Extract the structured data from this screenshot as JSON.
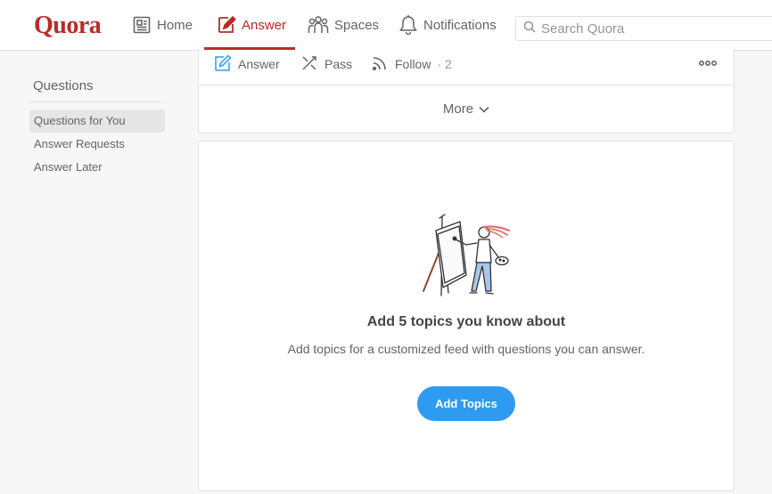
{
  "header": {
    "logo": "Quora",
    "nav": [
      {
        "label": "Home",
        "icon": "home-icon"
      },
      {
        "label": "Answer",
        "icon": "answer-pencil-icon",
        "active": true
      },
      {
        "label": "Spaces",
        "icon": "spaces-people-icon"
      },
      {
        "label": "Notifications",
        "icon": "bell-icon"
      }
    ],
    "search_placeholder": "Search Quora"
  },
  "sidebar": {
    "title": "Questions",
    "items": [
      {
        "label": "Questions for You",
        "active": true
      },
      {
        "label": "Answer Requests"
      },
      {
        "label": "Answer Later"
      }
    ]
  },
  "question_actions": {
    "answer": "Answer",
    "pass": "Pass",
    "follow": "Follow",
    "follow_count": "· 2",
    "more": "More"
  },
  "empty_state": {
    "title": "Add 5 topics you know about",
    "subtitle": "Add topics for a customized feed with questions you can answer.",
    "button": "Add Topics"
  },
  "colors": {
    "brand": "#b92b27",
    "button_blue": "#2e9bf0",
    "active_link_blue": "#2e9bf0"
  }
}
